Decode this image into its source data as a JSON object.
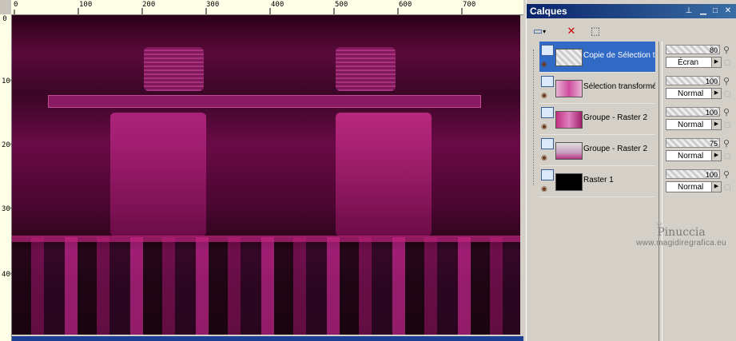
{
  "ruler": {
    "h_ticks": [
      "0",
      "100",
      "200",
      "300",
      "400",
      "500",
      "600",
      "700"
    ],
    "v_ticks": [
      "0",
      "100",
      "200",
      "300",
      "400"
    ]
  },
  "panel": {
    "title": "Calques",
    "title_buttons": [
      "pin-icon",
      "minimize-icon",
      "maximize-icon",
      "close-icon"
    ]
  },
  "toolbar": {
    "tools": [
      {
        "name": "new-layer-icon",
        "glyph": "▭"
      },
      {
        "name": "delete-layer-icon",
        "glyph": "✕"
      },
      {
        "name": "edit-selection-icon",
        "glyph": "⬚"
      }
    ]
  },
  "layers": [
    {
      "name": "Copie de Sélection tra",
      "opacity": "80",
      "blend": "Écran",
      "selected": true
    },
    {
      "name": "Sélection transformée",
      "opacity": "100",
      "blend": "Normal",
      "selected": false
    },
    {
      "name": "Groupe - Raster 2",
      "opacity": "100",
      "blend": "Normal",
      "selected": false
    },
    {
      "name": "Groupe - Raster 2",
      "opacity": "75",
      "blend": "Normal",
      "selected": false
    },
    {
      "name": "Raster 1",
      "opacity": "100",
      "blend": "Normal",
      "selected": false
    }
  ],
  "watermark": {
    "name": "Pinuccia",
    "url": "www.magidiregrafica.eu"
  },
  "colors": {
    "accent": "#316ac5",
    "title_bar": "#0a246a",
    "canvas_magenta": "#9a1a70"
  }
}
